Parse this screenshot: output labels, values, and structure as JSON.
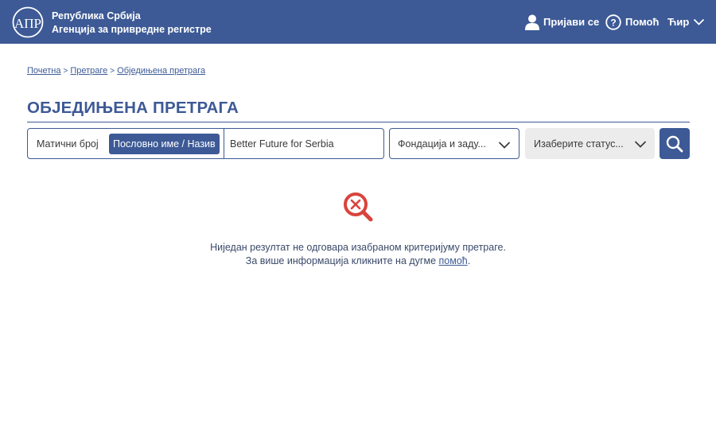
{
  "header": {
    "brand_line1": "Република Србија",
    "brand_line2": "Агенција за привредне регистре",
    "login_label": "Пријави се",
    "help_label": "Помоћ",
    "lang_label": "Ћир",
    "color": "#3d5a96",
    "logo_text": "АПР"
  },
  "breadcrumb": {
    "items": [
      "Почетна",
      "Претраге",
      "Обједињена претрага"
    ],
    "separator": ">"
  },
  "page": {
    "title": "ОБЈЕДИЊЕНА ПРЕТРАГА"
  },
  "search": {
    "mode_options": [
      "Матични број",
      "Пословно име / Назив"
    ],
    "selected_mode": "Пословно име / Назив",
    "query_value": "Better Future for Serbia",
    "type_select_value": "Фондација и заду...",
    "status_select_value": "Изаберите статус...",
    "button_icon": "search-icon"
  },
  "no_result": {
    "icon": "no-result-icon",
    "line1": "Ниједан резултат не одговара изабраном критеријуму претраге.",
    "line2_prefix": "За више информација кликните на дугме ",
    "line2_link": "помоћ",
    "line2_suffix": ".",
    "icon_color": "#d9443b"
  }
}
